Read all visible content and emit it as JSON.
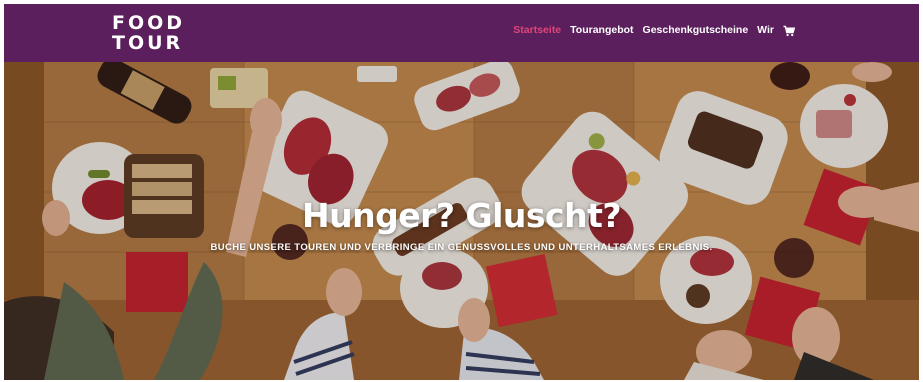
{
  "brand": {
    "logo_line1": "FOOD",
    "logo_line2": "TOUR"
  },
  "nav": {
    "items": [
      {
        "label": "Startseite",
        "active": true
      },
      {
        "label": "Tourangebot",
        "active": false
      },
      {
        "label": "Geschenkgutscheine",
        "active": false
      },
      {
        "label": "Wir",
        "active": false
      }
    ],
    "cart_icon": "cart-icon"
  },
  "hero": {
    "title": "Hunger? Gluscht?",
    "subtitle": "BUCHE UNSERE TOUREN UND VERBRINGE EIN GENUSSVOLLES UND UNTERHALTSAMES ERLEBNIS."
  },
  "colors": {
    "header_bg": "#5a1f5c",
    "nav_active": "#e0457a",
    "nav_text": "#ffffff"
  }
}
